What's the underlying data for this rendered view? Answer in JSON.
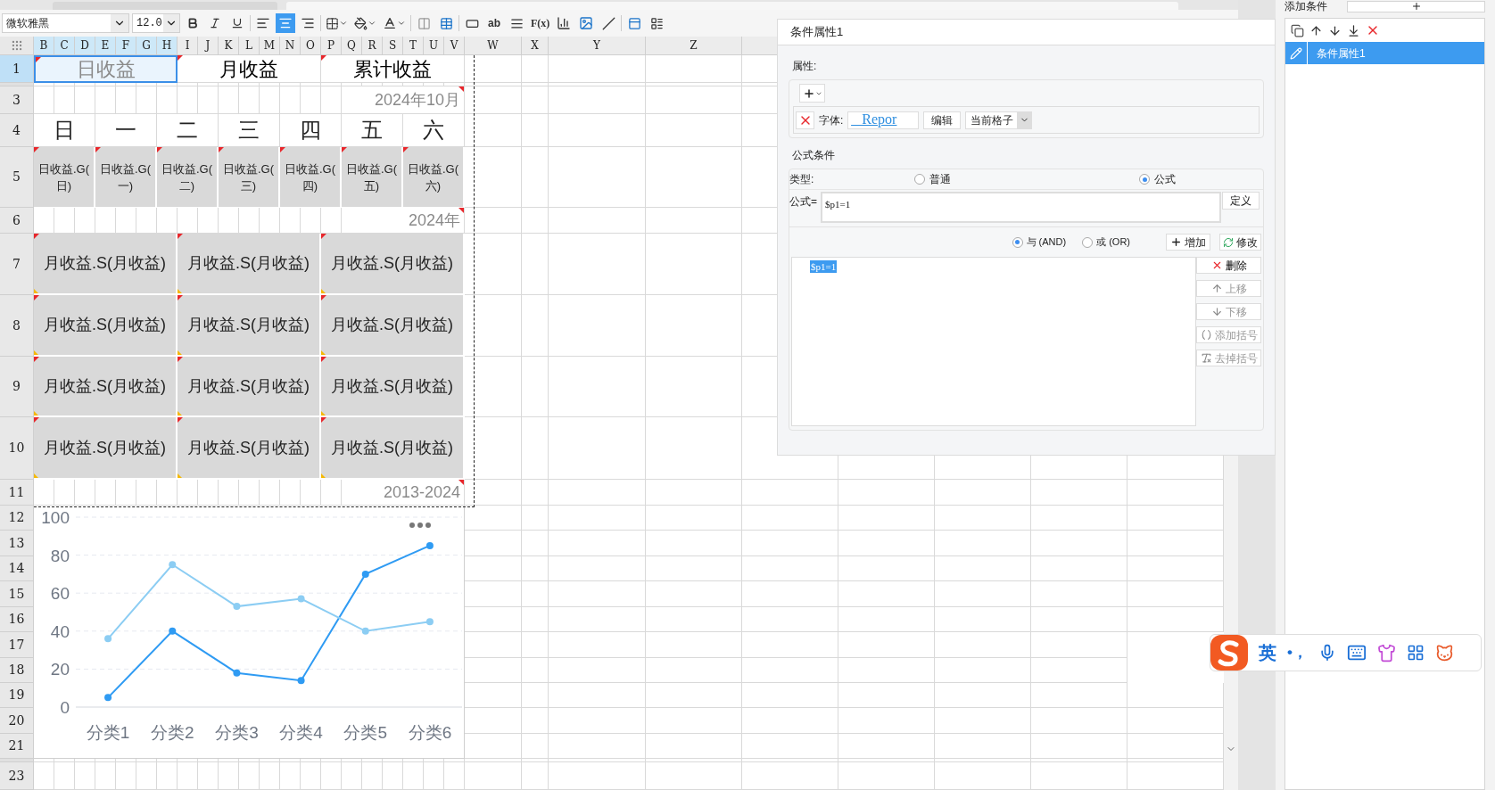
{
  "toolbar": {
    "font": "微软雅黑",
    "size": "12.0",
    "align": [
      {
        "selected": false
      },
      {
        "selected": true
      },
      {
        "selected": false
      }
    ],
    "text_tools": [
      "ab",
      "F(x)"
    ]
  },
  "sheet": {
    "columns": [
      {
        "label": "B",
        "selected": true
      },
      {
        "label": "C",
        "selected": true
      },
      {
        "label": "D",
        "selected": true
      },
      {
        "label": "E",
        "selected": true
      },
      {
        "label": "F",
        "selected": true
      },
      {
        "label": "G",
        "selected": true
      },
      {
        "label": "H",
        "selected": true
      },
      {
        "label": "I",
        "selected": false
      },
      {
        "label": "J",
        "selected": false
      },
      {
        "label": "K",
        "selected": false
      },
      {
        "label": "L",
        "selected": false
      },
      {
        "label": "M",
        "selected": false
      },
      {
        "label": "N",
        "selected": false
      },
      {
        "label": "O",
        "selected": false
      },
      {
        "label": "P",
        "selected": false
      },
      {
        "label": "Q",
        "selected": false
      },
      {
        "label": "R",
        "selected": false
      },
      {
        "label": "S",
        "selected": false
      },
      {
        "label": "T",
        "selected": false
      },
      {
        "label": "U",
        "selected": false
      },
      {
        "label": "V",
        "selected": false
      },
      {
        "label": "W",
        "selected": false
      },
      {
        "label": "X",
        "selected": false
      },
      {
        "label": "Y",
        "selected": false
      },
      {
        "label": "Z",
        "selected": false
      }
    ],
    "rows": [
      {
        "label": "1",
        "selected": true
      },
      {
        "label": "3",
        "selected": false
      },
      {
        "label": "4",
        "selected": false
      },
      {
        "label": "5",
        "selected": false
      },
      {
        "label": "6",
        "selected": false
      },
      {
        "label": "7",
        "selected": false
      },
      {
        "label": "8",
        "selected": false
      },
      {
        "label": "9",
        "selected": false
      },
      {
        "label": "10",
        "selected": false
      },
      {
        "label": "11",
        "selected": false
      },
      {
        "label": "12",
        "selected": false
      },
      {
        "label": "13",
        "selected": false
      },
      {
        "label": "14",
        "selected": false
      },
      {
        "label": "15",
        "selected": false
      },
      {
        "label": "16",
        "selected": false
      },
      {
        "label": "17",
        "selected": false
      },
      {
        "label": "18",
        "selected": false
      },
      {
        "label": "19",
        "selected": false
      },
      {
        "label": "20",
        "selected": false
      },
      {
        "label": "21",
        "selected": false
      },
      {
        "label": "23",
        "selected": false
      }
    ],
    "title_row": [
      {
        "text": "日收益",
        "selected": true
      },
      {
        "text": "月收益",
        "selected": false
      },
      {
        "text": "累计收益",
        "selected": false
      }
    ],
    "month_label": "2024年10月",
    "weekdays": [
      "日",
      "一",
      "二",
      "三",
      "四",
      "五",
      "六"
    ],
    "day_cells": [
      "日收益.G(日)",
      "日收益.G(一)",
      "日收益.G(二)",
      "日收益.G(三)",
      "日收益.G(四)",
      "日收益.G(五)",
      "日收益.G(六)"
    ],
    "year_label": "2024年",
    "month_cells": [
      [
        "月收益.S(月收益)",
        "月收益.S(月收益)",
        "月收益.S(月收益)"
      ],
      [
        "月收益.S(月收益)",
        "月收益.S(月收益)",
        "月收益.S(月收益)"
      ],
      [
        "月收益.S(月收益)",
        "月收益.S(月收益)",
        "月收益.S(月收益)"
      ],
      [
        "月收益.S(月收益)",
        "月收益.S(月收益)",
        "月收益.S(月收益)"
      ]
    ],
    "range_label": "2013-2024",
    "chart_data": {
      "type": "line",
      "categories": [
        "分类1",
        "分类2",
        "分类3",
        "分类4",
        "分类5",
        "分类6"
      ],
      "series": [
        {
          "color": "#2f9bf3",
          "marker": "circle",
          "values": [
            5,
            40,
            18,
            14,
            70,
            85
          ]
        },
        {
          "color": "#8ccdf3",
          "marker": "circle",
          "values": [
            36,
            75,
            53,
            57,
            40,
            45
          ]
        }
      ],
      "ylim": [
        0,
        100
      ],
      "yticks": [
        0,
        20,
        40,
        60,
        80,
        100
      ],
      "grid": true
    }
  },
  "dialog": {
    "title": "条件属性1",
    "properties_label": "属性:",
    "property": {
      "label": "字体:",
      "preview": "_ Repor",
      "edit_button": "编辑",
      "scope": "当前格子"
    },
    "formula_section": "公式条件",
    "type_label": "类型:",
    "types": [
      {
        "label": "普通",
        "selected": false
      },
      {
        "label": "公式",
        "selected": true
      }
    ],
    "formula_label": "公式=",
    "formula": "$p1=1",
    "define_button": "定义",
    "joins": [
      {
        "label": "与 (AND)",
        "selected": true
      },
      {
        "label": "或 (OR)",
        "selected": false
      }
    ],
    "add_button": "增加",
    "modify_button": "修改",
    "conditions": [
      {
        "text": "$p1=1",
        "selected": true
      }
    ],
    "actions": [
      {
        "label": "删除",
        "disabled": false
      },
      {
        "label": "上移",
        "disabled": true
      },
      {
        "label": "下移",
        "disabled": true
      },
      {
        "label": "添加括号",
        "disabled": true
      },
      {
        "label": "去掉括号",
        "disabled": true
      }
    ]
  },
  "side_panel": {
    "add_label": "添加条件",
    "items": [
      {
        "label": "条件属性1",
        "selected": true
      }
    ]
  },
  "ime": {
    "language": "英",
    "punctuation": "•，"
  }
}
